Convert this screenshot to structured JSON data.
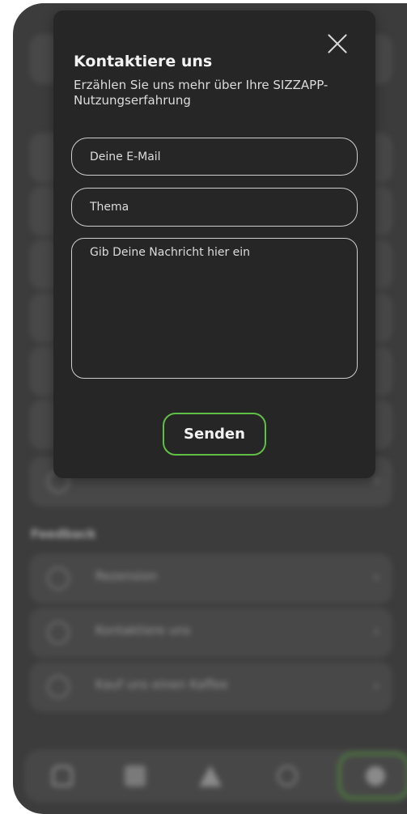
{
  "background": {
    "section_label": "Feedback",
    "rows": [
      {
        "label": "Rezension"
      },
      {
        "label": "Kontaktiere uns"
      },
      {
        "label": "Kauf uns einen Kaffee"
      }
    ]
  },
  "modal": {
    "title": "Kontaktiere uns",
    "subtitle": "Erzählen Sie uns mehr über Ihre SIZZAPP-Nutzungserfahrung",
    "email_placeholder": "Deine E-Mail",
    "topic_placeholder": "Thema",
    "message_placeholder": "Gib Deine Nachricht hier ein",
    "send_label": "Senden"
  },
  "colors": {
    "accent_green": "#5fbf47",
    "modal_bg": "#262626",
    "overlay_bg": "#3c3c3c"
  },
  "icons": {
    "close": "close-icon",
    "tabbar": [
      "home-icon",
      "grid-icon",
      "chef-icon",
      "timer-icon",
      "settings-icon"
    ]
  }
}
